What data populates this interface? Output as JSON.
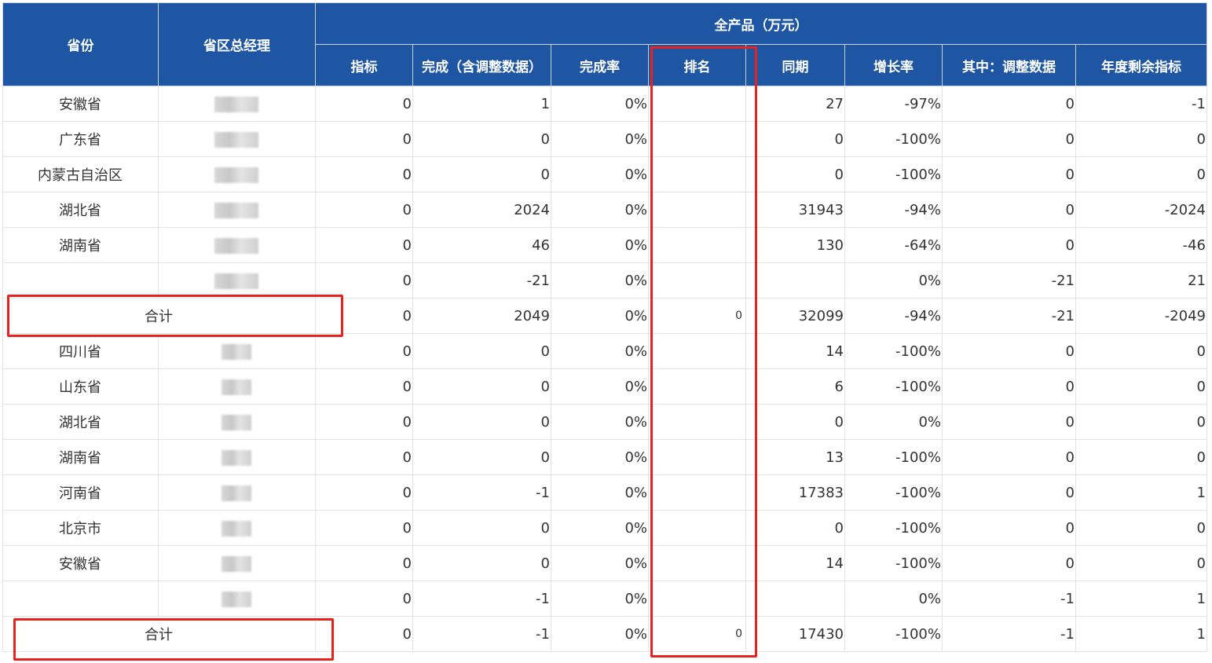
{
  "table": {
    "headers": {
      "province": "省份",
      "manager": "省区总经理",
      "group": "全产品（万元）",
      "columns": [
        "指标",
        "完成（含调整数据）",
        "完成率",
        "排名",
        "同期",
        "增长率",
        "其中：调整数据",
        "年度剩余指标"
      ]
    },
    "rows": [
      {
        "province": "安徽省",
        "cells": [
          "0",
          "1",
          "0%",
          "",
          "27",
          "-97%",
          "0",
          "-1"
        ]
      },
      {
        "province": "广东省",
        "cells": [
          "0",
          "0",
          "0%",
          "",
          "0",
          "-100%",
          "0",
          "0"
        ]
      },
      {
        "province": "内蒙古自治区",
        "cells": [
          "0",
          "0",
          "0%",
          "",
          "0",
          "-100%",
          "0",
          "0"
        ]
      },
      {
        "province": "湖北省",
        "cells": [
          "0",
          "2024",
          "0%",
          "",
          "31943",
          "-94%",
          "0",
          "-2024"
        ]
      },
      {
        "province": "湖南省",
        "cells": [
          "0",
          "46",
          "0%",
          "",
          "130",
          "-64%",
          "0",
          "-46"
        ]
      },
      {
        "province": "",
        "cells": [
          "0",
          "-21",
          "0%",
          "",
          "",
          "0%",
          "-21",
          "21"
        ]
      },
      {
        "total_label": "合计",
        "cells": [
          "0",
          "2049",
          "0%",
          "0",
          "32099",
          "-94%",
          "-21",
          "-2049"
        ]
      },
      {
        "province": "四川省",
        "cells": [
          "0",
          "0",
          "0%",
          "",
          "14",
          "-100%",
          "0",
          "0"
        ]
      },
      {
        "province": "山东省",
        "cells": [
          "0",
          "0",
          "0%",
          "",
          "6",
          "-100%",
          "0",
          "0"
        ]
      },
      {
        "province": "湖北省",
        "cells": [
          "0",
          "0",
          "0%",
          "",
          "0",
          "0%",
          "0",
          "0"
        ]
      },
      {
        "province": "湖南省",
        "cells": [
          "0",
          "0",
          "0%",
          "",
          "13",
          "-100%",
          "0",
          "0"
        ]
      },
      {
        "province": "河南省",
        "cells": [
          "0",
          "-1",
          "0%",
          "",
          "17383",
          "-100%",
          "0",
          "1"
        ]
      },
      {
        "province": "北京市",
        "cells": [
          "0",
          "0",
          "0%",
          "",
          "0",
          "-100%",
          "0",
          "0"
        ]
      },
      {
        "province": "安徽省",
        "cells": [
          "0",
          "0",
          "0%",
          "",
          "14",
          "-100%",
          "0",
          "0"
        ]
      },
      {
        "province": "",
        "cells": [
          "0",
          "-1",
          "0%",
          "",
          "",
          "0%",
          "-1",
          "1"
        ]
      },
      {
        "total_label": "合计",
        "cells": [
          "0",
          "-1",
          "0%",
          "0",
          "17430",
          "-100%",
          "-1",
          "1"
        ]
      }
    ]
  },
  "colors": {
    "header_bg": "#1e56a3",
    "highlight": "#e8221f"
  }
}
